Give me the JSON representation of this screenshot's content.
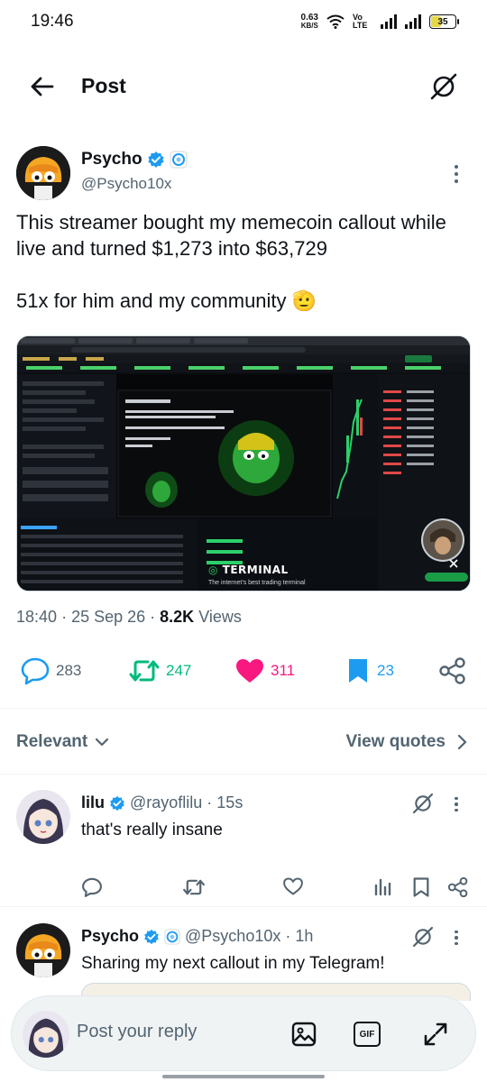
{
  "status_bar": {
    "time": "19:46",
    "net_speed": "0.63",
    "net_unit": "KB/S",
    "volte": "Vo LTE",
    "battery": "35"
  },
  "header": {
    "title": "Post"
  },
  "post": {
    "author_name": "Psycho",
    "author_handle": "@Psycho10x",
    "text": "This streamer bought my memecoin callout while live and turned $1,273 into $63,729\n\n51x for him and my community 🫡",
    "media_caption": "TERMINAL",
    "media_subcaption": "The internet's best trading terminal",
    "time": "18:40",
    "date": "25 Sep 26",
    "views_count": "8.2K",
    "views_label": "Views",
    "replies": "283",
    "reposts": "247",
    "likes": "311",
    "bookmarks": "23"
  },
  "sort": {
    "left": "Relevant",
    "right": "View quotes"
  },
  "replies": [
    {
      "name": "lilu",
      "handle": "@rayoflilu",
      "time": "· 15s",
      "text": "that's really insane"
    },
    {
      "name": "Psycho",
      "handle": "@Psycho10x",
      "time": "· 1h",
      "text": "Sharing my next callout in my Telegram!"
    }
  ],
  "composer": {
    "placeholder": "Post your reply",
    "gif_label": "GIF"
  },
  "colors": {
    "accent": "#1d9bf0",
    "repost": "#00ba7c",
    "like": "#f91880",
    "muted": "#536471"
  }
}
